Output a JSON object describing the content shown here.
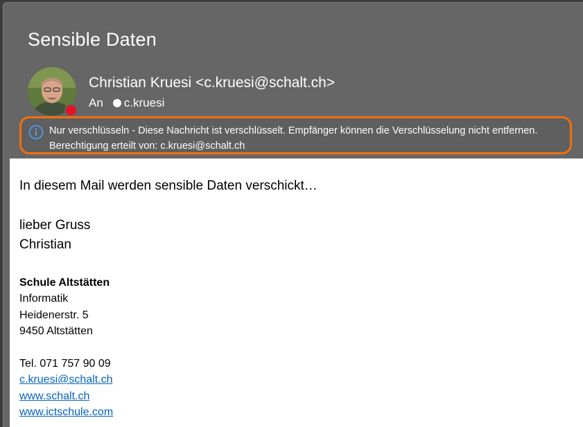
{
  "message": {
    "subject": "Sensible Daten",
    "sender": "Christian Kruesi <c.kruesi@schalt.ch>",
    "to_label": "An",
    "recipient": "c.kruesi",
    "presence_color": "#e81123"
  },
  "encryption_banner": {
    "icon": "info-icon",
    "line1": "Nur verschlüsseln - Diese Nachricht ist verschlüsselt. Empfänger können die Verschlüsselung nicht entfernen.",
    "line2": "Berechtigung erteilt von: c.kruesi@schalt.ch",
    "border_color": "#f07010"
  },
  "body": {
    "intro": "In diesem Mail werden sensible Daten verschickt…",
    "greeting": "lieber Gruss",
    "name": "Christian"
  },
  "signature": {
    "org": "Schule Altstätten",
    "department": "Informatik",
    "street": "Heidenerstr. 5",
    "city": "9450 Altstätten",
    "phone": "Tel. 071 757 90 09",
    "email": "c.kruesi@schalt.ch",
    "website1": "www.schalt.ch",
    "website2": "www.ictschule.com"
  }
}
